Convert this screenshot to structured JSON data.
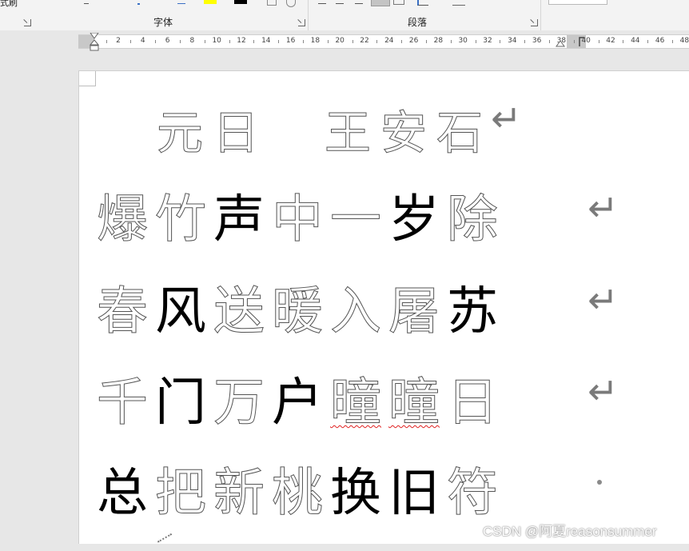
{
  "ribbon": {
    "format_painter_label": "式刷",
    "font_group_label": "字体",
    "paragraph_group_label": "段落",
    "highlight_color": "#ffff00",
    "font_color_swatch": "#000000"
  },
  "ruler": {
    "ticks": [
      "2",
      "4",
      "6",
      "8",
      "10",
      "12",
      "14",
      "16",
      "18",
      "20",
      "22",
      "24",
      "26",
      "28",
      "30",
      "32",
      "34",
      "36",
      "38",
      "40",
      "42",
      "44",
      "46",
      "48"
    ]
  },
  "document": {
    "lines": [
      [
        {
          "t": "元",
          "s": "trace"
        },
        {
          "t": "日",
          "s": "trace"
        },
        {
          "t": "",
          "s": "space"
        },
        {
          "t": "王",
          "s": "trace"
        },
        {
          "t": "安",
          "s": "trace"
        },
        {
          "t": "石",
          "s": "trace"
        }
      ],
      [
        {
          "t": "爆",
          "s": "trace"
        },
        {
          "t": "竹",
          "s": "trace"
        },
        {
          "t": "声",
          "s": "solid"
        },
        {
          "t": "中",
          "s": "trace"
        },
        {
          "t": "一",
          "s": "trace"
        },
        {
          "t": "岁",
          "s": "solid"
        },
        {
          "t": "除",
          "s": "trace"
        }
      ],
      [
        {
          "t": "春",
          "s": "trace"
        },
        {
          "t": "风",
          "s": "solid"
        },
        {
          "t": "送",
          "s": "trace"
        },
        {
          "t": "暖",
          "s": "trace"
        },
        {
          "t": "入",
          "s": "trace"
        },
        {
          "t": "屠",
          "s": "trace"
        },
        {
          "t": "苏",
          "s": "solid"
        }
      ],
      [
        {
          "t": "千",
          "s": "trace"
        },
        {
          "t": "门",
          "s": "solid"
        },
        {
          "t": "万",
          "s": "trace"
        },
        {
          "t": "户",
          "s": "solid"
        },
        {
          "t": "曈",
          "s": "spell"
        },
        {
          "t": "曈",
          "s": "spell"
        },
        {
          "t": "日",
          "s": "trace"
        }
      ],
      [
        {
          "t": "总",
          "s": "solid"
        },
        {
          "t": "把",
          "s": "trace"
        },
        {
          "t": "新",
          "s": "trace"
        },
        {
          "t": "桃",
          "s": "trace"
        },
        {
          "t": "换",
          "s": "solid"
        },
        {
          "t": "旧",
          "s": "solid"
        },
        {
          "t": "符",
          "s": "trace"
        }
      ]
    ],
    "paragraph_mark": "↵"
  },
  "watermark": "CSDN @阿夏reasonsummer"
}
